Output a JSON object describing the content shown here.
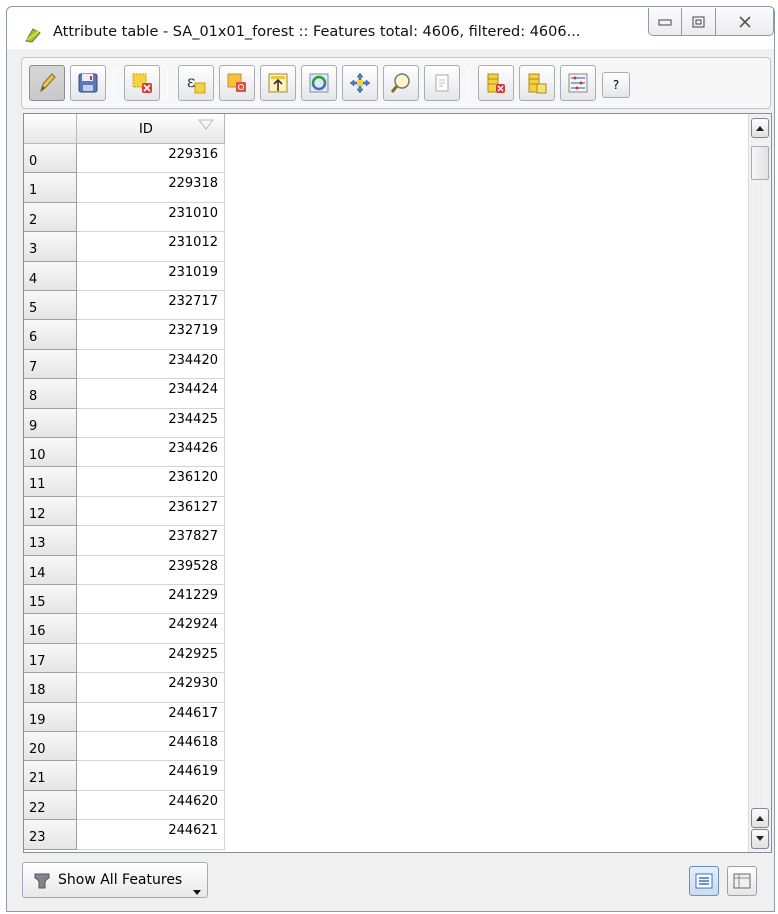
{
  "window": {
    "title": "Attribute table - SA_01x01_forest :: Features total: 4606, filtered: 4606...",
    "icon": "qgis-table-icon"
  },
  "toolbar": {
    "buttons": [
      {
        "name": "toggle-editing-button",
        "icon": "pencil-icon"
      },
      {
        "name": "save-edits-button",
        "icon": "save-icon"
      },
      {
        "name": "delete-selected-button",
        "icon": "delete-features-icon"
      },
      {
        "name": "select-by-expression-button",
        "icon": "expression-icon"
      },
      {
        "name": "deselect-all-button",
        "icon": "deselect-icon"
      },
      {
        "name": "move-selection-to-top-button",
        "icon": "move-to-top-icon"
      },
      {
        "name": "invert-selection-button",
        "icon": "invert-selection-icon"
      },
      {
        "name": "pan-to-selected-button",
        "icon": "pan-icon"
      },
      {
        "name": "zoom-to-selected-button",
        "icon": "zoom-icon"
      },
      {
        "name": "copy-selected-button",
        "icon": "copy-icon"
      },
      {
        "name": "delete-column-button",
        "icon": "delete-column-icon"
      },
      {
        "name": "new-column-button",
        "icon": "new-column-icon"
      },
      {
        "name": "field-calculator-button",
        "icon": "field-calculator-icon"
      }
    ],
    "help_label": "?"
  },
  "table": {
    "columns": [
      "ID"
    ],
    "rows": [
      {
        "index": "0",
        "id": "229316"
      },
      {
        "index": "1",
        "id": "229318"
      },
      {
        "index": "2",
        "id": "231010"
      },
      {
        "index": "3",
        "id": "231012"
      },
      {
        "index": "4",
        "id": "231019"
      },
      {
        "index": "5",
        "id": "232717"
      },
      {
        "index": "6",
        "id": "232719"
      },
      {
        "index": "7",
        "id": "234420"
      },
      {
        "index": "8",
        "id": "234424"
      },
      {
        "index": "9",
        "id": "234425"
      },
      {
        "index": "10",
        "id": "234426"
      },
      {
        "index": "11",
        "id": "236120"
      },
      {
        "index": "12",
        "id": "236127"
      },
      {
        "index": "13",
        "id": "237827"
      },
      {
        "index": "14",
        "id": "239528"
      },
      {
        "index": "15",
        "id": "241229"
      },
      {
        "index": "16",
        "id": "242924"
      },
      {
        "index": "17",
        "id": "242925"
      },
      {
        "index": "18",
        "id": "242930"
      },
      {
        "index": "19",
        "id": "244617"
      },
      {
        "index": "20",
        "id": "244618"
      },
      {
        "index": "21",
        "id": "244619"
      },
      {
        "index": "22",
        "id": "244620"
      },
      {
        "index": "23",
        "id": "244621"
      }
    ]
  },
  "footer": {
    "filter_label": "Show All Features"
  },
  "colors": {
    "window_border": "#8a9aab",
    "selection_accent": "#6f8fb8"
  }
}
